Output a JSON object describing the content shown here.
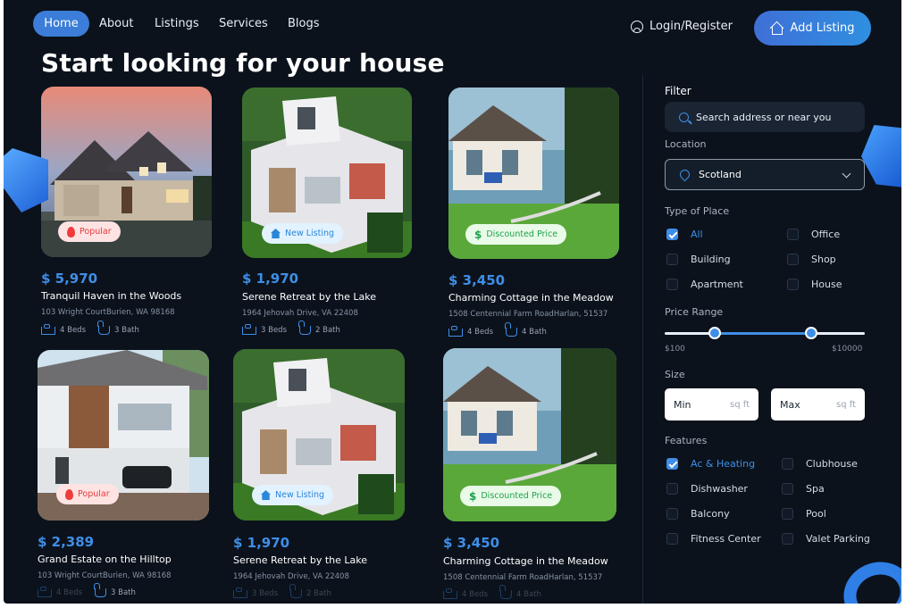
{
  "nav": {
    "links": [
      "Home",
      "About",
      "Listings",
      "Services",
      "Blogs"
    ],
    "login": "Login/Register",
    "add_listing": "Add Listing"
  },
  "page_title": "Start looking for your house",
  "listings": [
    {
      "price": "$ 5,970",
      "name": "Tranquil Haven in the Woods",
      "address": "103 Wright CourtBurien, WA 98168",
      "beds": "4 Beds",
      "baths": "3 Bath",
      "badge": "Popular"
    },
    {
      "price": "$ 1,970",
      "name": "Serene Retreat by the Lake",
      "address": "1964 Jehovah Drive, VA 22408",
      "beds": "3 Beds",
      "baths": "2 Bath",
      "badge": "New Listing"
    },
    {
      "price": "$ 3,450",
      "name": "Charming Cottage in the Meadow",
      "address": "1508 Centennial Farm RoadHarlan, 51537",
      "beds": "4 Beds",
      "baths": "4 Bath",
      "badge": "Discounted Price"
    },
    {
      "price": "$ 2,389",
      "name": "Grand Estate on the Hilltop",
      "address": "103 Wright CourtBurien, WA 98168",
      "beds": "4 Beds",
      "baths": "3 Bath",
      "badge": "Popular"
    },
    {
      "price": "$ 1,970",
      "name": "Serene Retreat by the Lake",
      "address": "1964 Jehovah Drive, VA 22408",
      "beds": "3 Beds",
      "baths": "2 Bath",
      "badge": "New Listing"
    },
    {
      "price": "$ 3,450",
      "name": "Charming Cottage in the Meadow",
      "address": "1508 Centennial Farm RoadHarlan, 51537",
      "beds": "4 Beds",
      "baths": "4 Bath",
      "badge": "Discounted Price"
    }
  ],
  "filter": {
    "title": "Filter",
    "search_placeholder": "Search address or near you",
    "location_label": "Location",
    "location_value": "Scotland",
    "type_label": "Type of Place",
    "types": [
      {
        "label": "All",
        "checked": true
      },
      {
        "label": "Office",
        "checked": false
      },
      {
        "label": "Building",
        "checked": false
      },
      {
        "label": "Shop",
        "checked": false
      },
      {
        "label": "Apartment",
        "checked": false
      },
      {
        "label": "House",
        "checked": false
      }
    ],
    "price_label": "Price Range",
    "price_min": "$100",
    "price_max": "$10000",
    "size_label": "Size",
    "size_min": "Min",
    "size_max": "Max",
    "size_unit": "sq ft",
    "features_label": "Features",
    "features": [
      {
        "label": "Ac & Heating",
        "checked": true
      },
      {
        "label": "Clubhouse",
        "checked": false
      },
      {
        "label": "Dishwasher",
        "checked": false
      },
      {
        "label": "Spa",
        "checked": false
      },
      {
        "label": "Balcony",
        "checked": false
      },
      {
        "label": "Pool",
        "checked": false
      },
      {
        "label": "Fitness Center",
        "checked": false
      },
      {
        "label": "Valet Parking",
        "checked": false
      }
    ]
  },
  "colors": {
    "accent": "#3f8ee6",
    "background": "#0b121c"
  }
}
